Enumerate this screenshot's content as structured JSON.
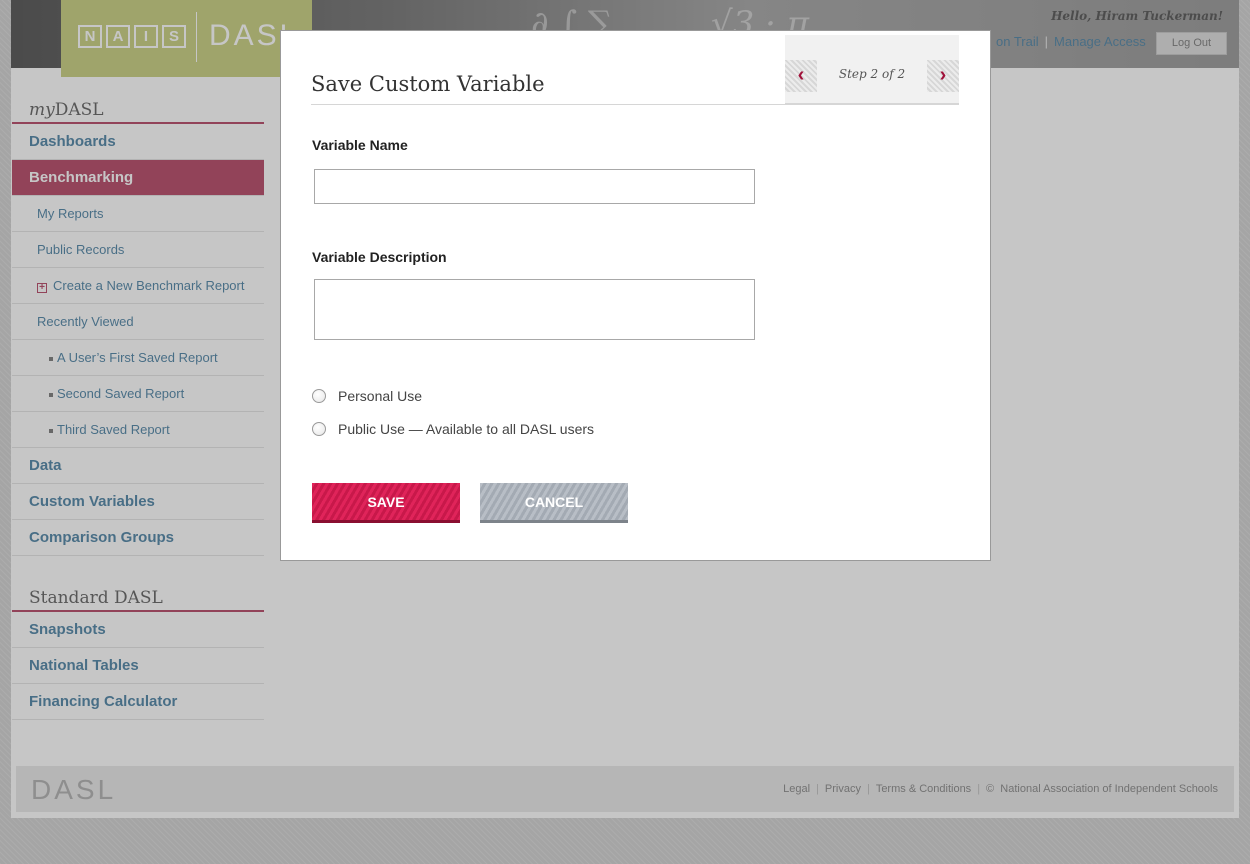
{
  "header": {
    "logo_marks": [
      "N",
      "A",
      "I",
      "S"
    ],
    "logo_text": "DASL",
    "greeting": "Hello, Hiram Tuckerman!",
    "nav_links": [
      "on Trail",
      "Manage Access"
    ],
    "logout_label": "Log Out"
  },
  "sidebar": {
    "my_heading_prefix": "my",
    "my_heading_suffix": "DASL",
    "items": {
      "dashboards": "Dashboards",
      "benchmarking": "Benchmarking",
      "my_reports": "My Reports",
      "public_records": "Public Records",
      "create_report": "Create a New Benchmark Report",
      "recently_viewed": "Recently Viewed",
      "recent_1": "A User’s First Saved Report",
      "recent_2": "Second Saved Report",
      "recent_3": "Third Saved Report",
      "data": "Data",
      "custom_variables": "Custom Variables",
      "comparison_groups": "Comparison Groups"
    },
    "standard_heading": "Standard DASL",
    "standard_items": {
      "snapshots": "Snapshots",
      "national_tables": "National Tables",
      "financing_calculator": "Financing Calculator"
    }
  },
  "modal": {
    "title": "Save Custom Variable",
    "step_label": "Step 2 of 2",
    "name_label": "Variable Name",
    "name_value": "",
    "description_label": "Variable Description",
    "description_value": "",
    "radio_personal": "Personal Use",
    "radio_public": "Public Use — Available to all DASL users",
    "save_label": "SAVE",
    "cancel_label": "CANCEL"
  },
  "footer": {
    "logo": "DASL",
    "links": [
      "Legal",
      "Privacy",
      "Terms & Conditions"
    ],
    "copyright_symbol": "©",
    "copyright": "National Association of Independent Schools"
  },
  "colors": {
    "accent": "#a0123a",
    "link": "#1b5f8a",
    "logo_bg": "#b8c25a",
    "save_button": "#e0245a",
    "cancel_button": "#b8bec6"
  },
  "icons": {
    "prev": "chevron-left-icon",
    "next": "chevron-right-icon",
    "create": "plus-box-icon"
  }
}
